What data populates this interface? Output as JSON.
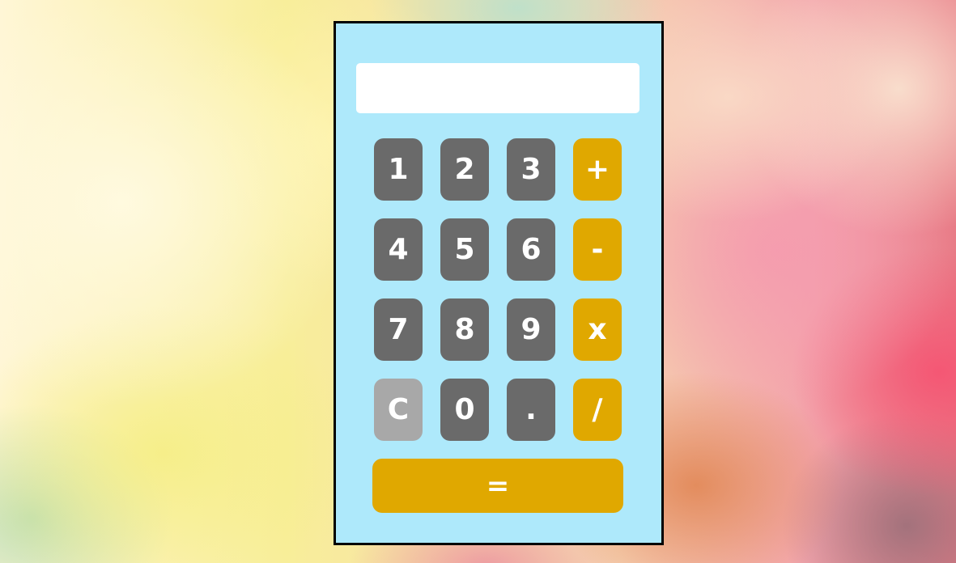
{
  "calculator": {
    "display_value": "",
    "keys": {
      "one": "1",
      "two": "2",
      "three": "3",
      "plus": "+",
      "four": "4",
      "five": "5",
      "six": "6",
      "minus": "-",
      "seven": "7",
      "eight": "8",
      "nine": "9",
      "multiply": "x",
      "clear": "C",
      "zero": "0",
      "decimal": ".",
      "divide": "/",
      "equals": "="
    },
    "colors": {
      "panel": "#aee9fb",
      "digit_key": "#6a6a6a",
      "operator_key": "#e0a800",
      "clear_key": "#a8a8a8",
      "display": "#ffffff",
      "key_text": "#ffffff"
    }
  }
}
